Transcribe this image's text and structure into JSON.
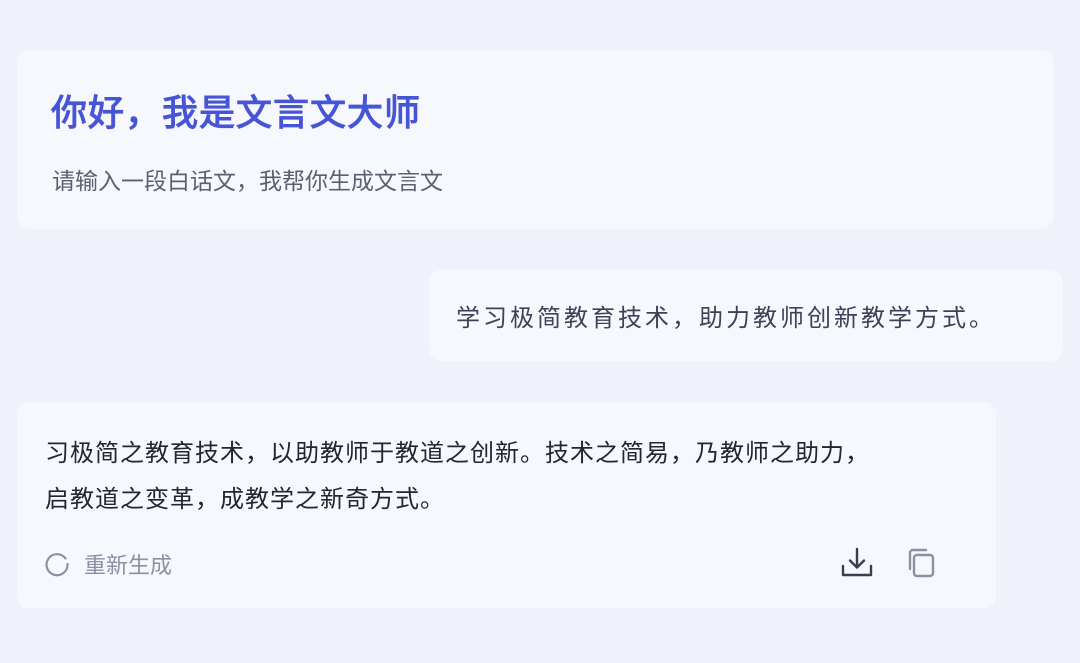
{
  "welcome": {
    "title": "你好，我是文言文大师",
    "subtitle": "请输入一段白话文，我帮你生成文言文"
  },
  "user_message": {
    "text": "学习极简教育技术，助力教师创新教学方式。"
  },
  "reply": {
    "lines": [
      "习极简之教育技术，以助教师于教道之创新。技术之简易，乃教师之助力，",
      "启教道之变革，成教学之新奇方式。"
    ],
    "regenerate_label": "重新生成",
    "icons": {
      "regenerate": "refresh-icon",
      "download": "download-icon",
      "copy": "copy-icon"
    }
  },
  "colors": {
    "background": "#f0f2fb",
    "card": "#f7f8fd",
    "title_accent": "#4654d6",
    "muted_text": "#8d90a3",
    "icon": "#3a3d4d"
  }
}
